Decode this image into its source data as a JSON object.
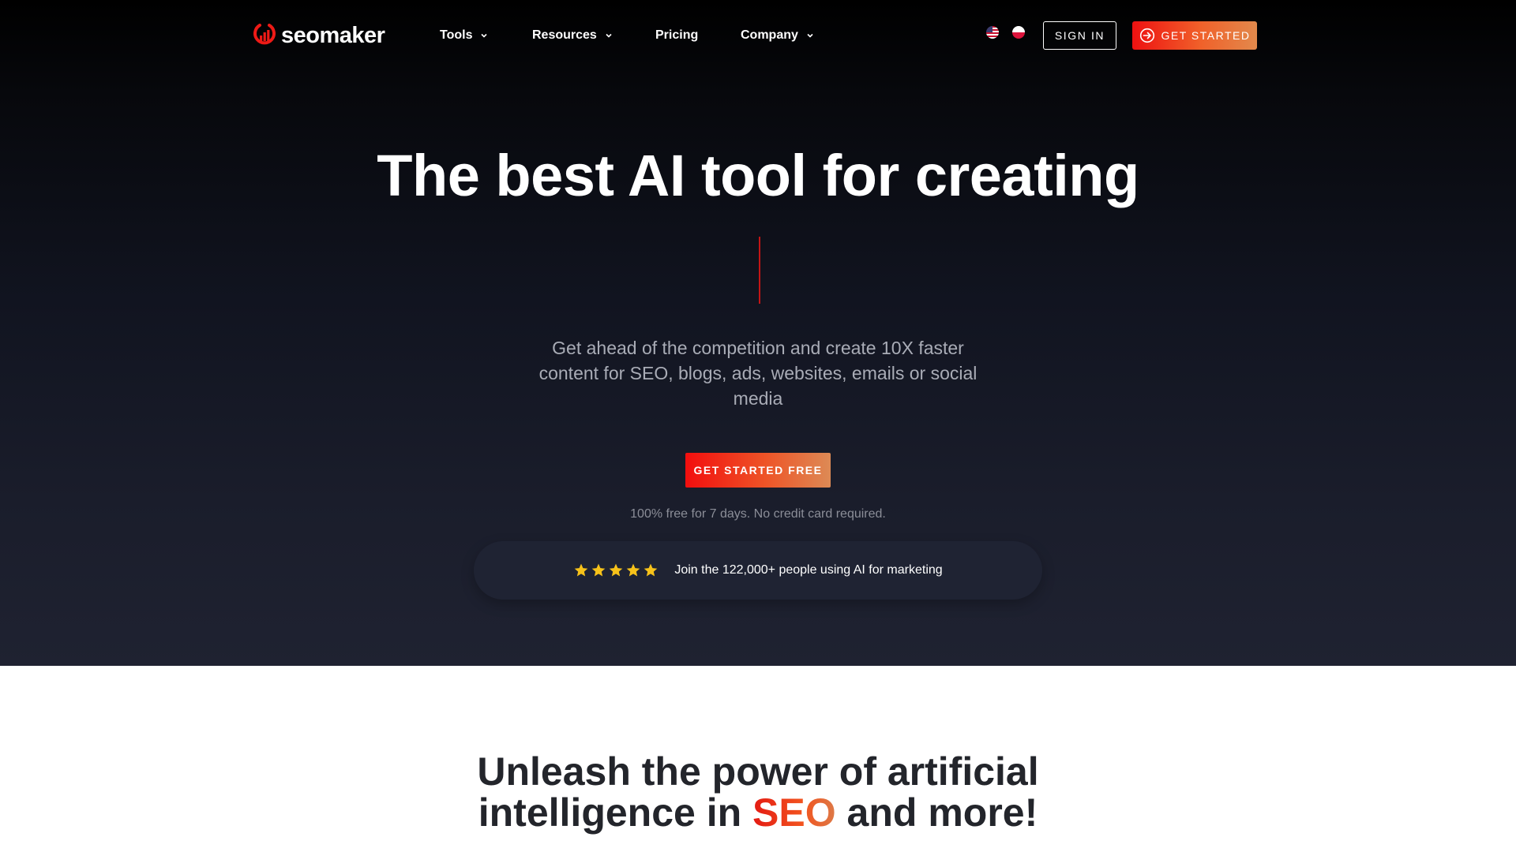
{
  "brand": {
    "name": "seomaker",
    "accent_color": "#ee1a16"
  },
  "nav": {
    "items": [
      {
        "label": "Tools",
        "has_dropdown": true
      },
      {
        "label": "Resources",
        "has_dropdown": true
      },
      {
        "label": "Pricing",
        "has_dropdown": false
      },
      {
        "label": "Company",
        "has_dropdown": true
      }
    ],
    "languages": [
      {
        "icon": "us-flag-icon"
      },
      {
        "icon": "pl-flag-icon"
      }
    ],
    "sign_in_label": "SIGN IN",
    "get_started_label": "GET STARTED"
  },
  "hero": {
    "title": "The best AI tool for creating",
    "subtitle": "Get ahead of the competition and create 10X faster content for SEO, blogs, ads, websites, emails or social media",
    "cta_label": "GET STARTED FREE",
    "note": "100% free for 7 days. No credit card required.",
    "social_proof": {
      "rating_stars": 5,
      "text": "Join the 122,000+ people using AI for marketing",
      "star_color": "#f7c21a"
    }
  },
  "section2": {
    "title_line1": "Unleash the power of artificial",
    "title_line2_before": "intelligence in ",
    "title_line2_accent": "SEO",
    "title_line2_after": " and more!"
  }
}
